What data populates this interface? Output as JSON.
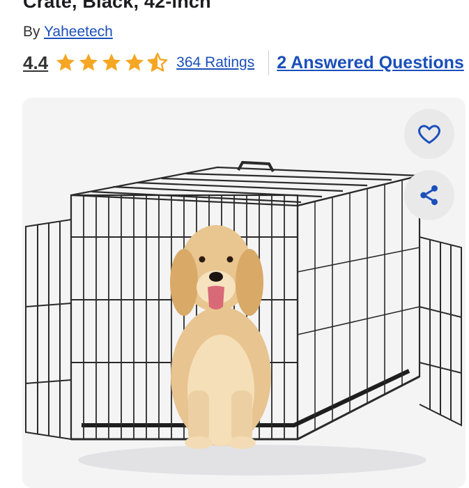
{
  "product": {
    "title": "Crate, Black, 42-inch",
    "by_prefix": "By",
    "brand": "Yaheetech"
  },
  "rating": {
    "score": "4.4",
    "stars_out_of_5": 4.4,
    "ratings_text": "364 Ratings",
    "answered_questions_text": "2 Answered Questions"
  },
  "image": {
    "subject": "Golden retriever sitting in a black wire crate with doors open"
  },
  "icons": {
    "favorite": "heart-icon",
    "share": "share-icon",
    "star": "star-icon"
  },
  "colors": {
    "link_blue": "#1a4fba",
    "star_orange": "#f5a623",
    "fab_bg": "#e9e9ea",
    "card_bg": "#f4f4f5"
  }
}
